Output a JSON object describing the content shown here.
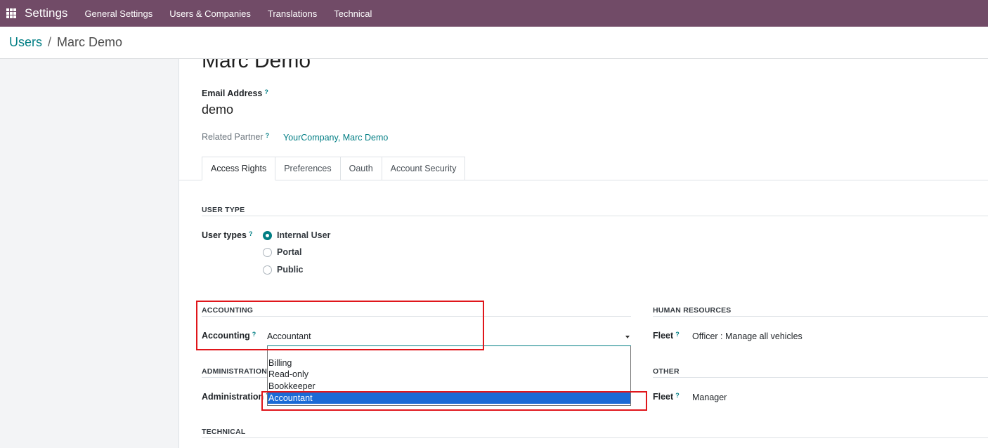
{
  "navbar": {
    "app_name": "Settings",
    "menu": [
      "General Settings",
      "Users & Companies",
      "Translations",
      "Technical"
    ]
  },
  "breadcrumb": {
    "parent": "Users",
    "separator": "/",
    "current": "Marc Demo"
  },
  "form": {
    "title": "Marc Demo",
    "email_label": "Email Address",
    "email_value": "demo",
    "partner_label": "Related Partner",
    "partner_value": "YourCompany, Marc Demo",
    "help_mark": "?"
  },
  "tabs": [
    "Access Rights",
    "Preferences",
    "Oauth",
    "Account Security"
  ],
  "user_type": {
    "heading": "USER TYPE",
    "label": "User types",
    "options": [
      "Internal User",
      "Portal",
      "Public"
    ],
    "selected": "Internal User"
  },
  "accounting": {
    "heading": "ACCOUNTING",
    "label": "Accounting",
    "value": "Accountant",
    "options": [
      "Billing",
      "Read-only",
      "Bookkeeper",
      "Accountant"
    ],
    "highlighted_option": "Accountant"
  },
  "human_resources": {
    "heading": "HUMAN RESOURCES",
    "label": "Fleet",
    "value": "Officer : Manage all vehicles"
  },
  "administration": {
    "heading": "ADMINISTRATION",
    "label": "Administration"
  },
  "other": {
    "heading": "OTHER",
    "label": "Fleet",
    "value": "Manager"
  },
  "technical": {
    "heading": "TECHNICAL"
  },
  "colors": {
    "navbar": "#714b67",
    "accent": "#017e84",
    "highlight_box": "#e0161b",
    "selected_option": "#1a6ad6"
  }
}
